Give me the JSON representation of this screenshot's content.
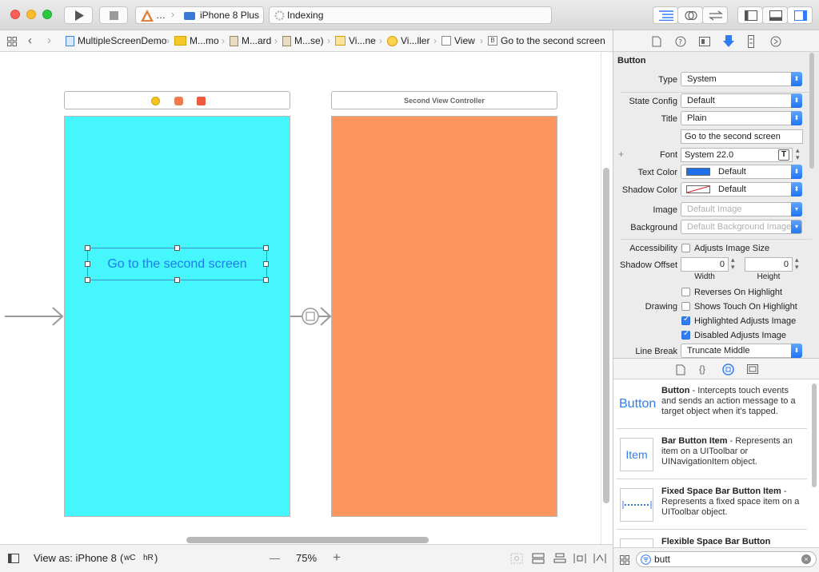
{
  "toolbar": {
    "scheme_app": "…",
    "scheme_device": "iPhone 8 Plus",
    "activity_status": "Indexing",
    "play_icon": "play-icon",
    "stop_icon": "stop-icon"
  },
  "jumpbar": {
    "crumbs": [
      "MultipleScreenDemo",
      "M...mo",
      "M...ard",
      "M...se)",
      "Vi...ne",
      "Vi...ller",
      "View",
      "Go to the second screen"
    ]
  },
  "canvas": {
    "second_scene_title": "Second View Controller",
    "button_title": "Go to the second screen",
    "first_view_color": "#45f7fc",
    "second_view_color": "#fe955f"
  },
  "bottombar": {
    "view_as_label": "View as: iPhone 8",
    "size_class_w": "wC",
    "size_class_h": "hR",
    "zoom": "75%",
    "zoom_out": "—",
    "zoom_in": "+"
  },
  "inspector": {
    "section": "Button",
    "type_label": "Type",
    "type_value": "System",
    "state_label": "State Config",
    "state_value": "Default",
    "title_label": "Title",
    "title_value": "Plain",
    "title_text": "Go to the second screen",
    "font_label": "Font",
    "font_value": "System 22.0",
    "text_color_label": "Text Color",
    "text_color_value": "Default",
    "shadow_color_label": "Shadow Color",
    "shadow_color_value": "Default",
    "image_label": "Image",
    "image_placeholder": "Default Image",
    "background_label": "Background",
    "background_placeholder": "Default Background Image",
    "accessibility_label": "Accessibility",
    "adjusts_image_size": "Adjusts Image Size",
    "shadow_offset_label": "Shadow Offset",
    "shadow_w": "0",
    "shadow_h": "0",
    "width_label": "Width",
    "height_label": "Height",
    "reverses": "Reverses On Highlight",
    "drawing_label": "Drawing",
    "shows_touch": "Shows Touch On Highlight",
    "highlighted_adjusts": "Highlighted Adjusts Image",
    "disabled_adjusts": "Disabled Adjusts Image",
    "line_break_label": "Line Break",
    "line_break_value": "Truncate Middle"
  },
  "library": {
    "items": [
      {
        "thumb": "Button",
        "name": "Button",
        "desc": " - Intercepts touch events and sends an action message to a target object when it's tapped."
      },
      {
        "thumb": "Item",
        "name": "Bar Button Item",
        "desc": " - Represents an item on a UIToolbar or UINavigationItem object."
      },
      {
        "thumb": "",
        "name": "Fixed Space Bar Button Item",
        "desc": " - Represents a fixed space item on a UIToolbar object."
      },
      {
        "thumb": "",
        "name": "Flexible Space Bar Button",
        "desc": ""
      }
    ],
    "filter_value": "butt"
  },
  "colors": {
    "accent": "#2f7cf6",
    "text_color_swatch": "#1f6fe8"
  }
}
